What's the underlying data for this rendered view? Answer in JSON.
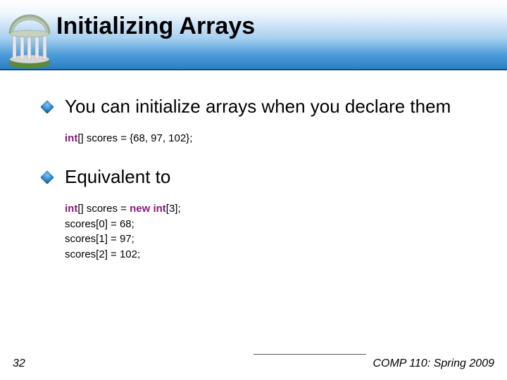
{
  "title": "Initializing Arrays",
  "bullets": [
    {
      "text": "You can initialize arrays when you declare them"
    },
    {
      "text": "Equivalent to"
    }
  ],
  "code1": {
    "kw1": "int",
    "rest1": "[] scores = {68, 97, 102};"
  },
  "code2": {
    "kw1": "int",
    "mid1": "[] scores = ",
    "kw2": "new int",
    "rest1": "[3];",
    "l2": "scores[0] = 68;",
    "l3": "scores[1] = 97;",
    "l4": "scores[2] = 102;"
  },
  "footer": {
    "page": "32",
    "course": "COMP 110: Spring 2009"
  }
}
